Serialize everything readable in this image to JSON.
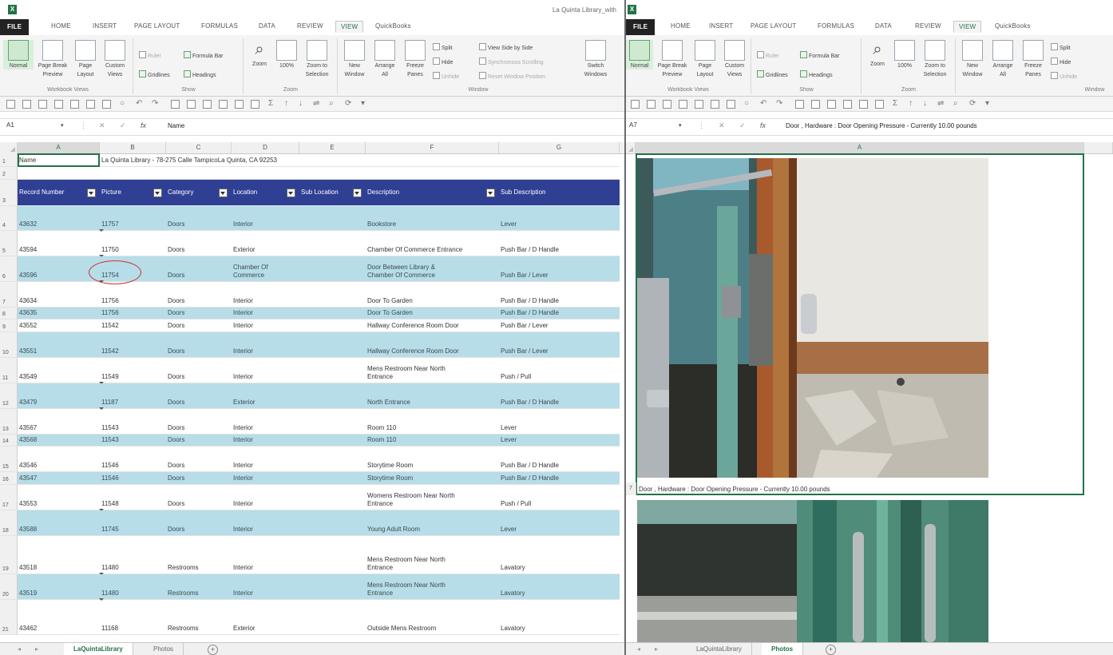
{
  "app": {
    "left_logo": "X",
    "right_logo": "X",
    "window_title": "La Quinta Library_with"
  },
  "ribbon": {
    "tabs": [
      "FILE",
      "HOME",
      "INSERT",
      "PAGE LAYOUT",
      "FORMULAS",
      "DATA",
      "REVIEW",
      "VIEW",
      "QuickBooks"
    ],
    "active_tab": "VIEW",
    "workbook_views": {
      "label": "Workbook Views",
      "normal": "Normal",
      "page_break_1": "Page Break",
      "page_break_2": "Preview",
      "page_layout_1": "Page",
      "page_layout_2": "Layout",
      "custom_1": "Custom",
      "custom_2": "Views"
    },
    "show": {
      "label": "Show",
      "ruler": "Ruler",
      "formula_bar": "Formula Bar",
      "gridlines": "Gridlines",
      "headings": "Headings"
    },
    "zoom": {
      "label": "Zoom",
      "zoom": "Zoom",
      "z100": "100%",
      "zts_1": "Zoom to",
      "zts_2": "Selection"
    },
    "window": {
      "label": "Window",
      "new_1": "New",
      "new_2": "Window",
      "arrange_1": "Arrange",
      "arrange_2": "All",
      "freeze_1": "Freeze",
      "freeze_2": "Panes",
      "split": "Split",
      "hide": "Hide",
      "unhide": "Unhide",
      "side_by_side": "View Side by Side",
      "sync_scroll": "Synchronous Scrolling",
      "reset_pos": "Reset Window Position",
      "switch_1": "Switch",
      "switch_2": "Windows"
    }
  },
  "left": {
    "namebox": "A1",
    "formula": "Name",
    "fx": "fx",
    "columns": [
      "A",
      "B",
      "C",
      "D",
      "E",
      "F",
      "G"
    ],
    "row1": {
      "num": "1",
      "a": "Name",
      "b": "La Quinta Library - 78-275 Calle TampicoLa Quinta, CA 92253"
    },
    "row2": {
      "num": "2"
    },
    "header": {
      "num": "3",
      "cells": [
        "Record Number",
        "Picture",
        "Category",
        "Location",
        "Sub Location",
        "Description",
        "Sub Description"
      ]
    },
    "rows": [
      {
        "num": "4",
        "rec": "43632",
        "pic": "11757",
        "cat": "Doors",
        "loc": "Interior",
        "desc": "Bookstore",
        "sub": "Lever"
      },
      {
        "num": "5",
        "rec": "43594",
        "pic": "11750",
        "cat": "Doors",
        "loc": "Exterior",
        "desc": "Chamber Of Commerce Entrance",
        "sub": "Push Bar / D Handle"
      },
      {
        "num": "6",
        "rec": "43596",
        "pic": "11754",
        "cat": "Doors",
        "loc_1": "Chamber Of",
        "loc_2": "Commerce",
        "desc_1": "Door Between Library &",
        "desc_2": "Chamber Of Commerce",
        "sub": "Push Bar / Lever"
      },
      {
        "num": "7",
        "rec": "43634",
        "pic": "11756",
        "cat": "Doors",
        "loc": "Interior",
        "desc": "Door To Garden",
        "sub": "Push Bar / D Handle"
      },
      {
        "num": "8",
        "rec": "43635",
        "pic": "11756",
        "cat": "Doors",
        "loc": "Interior",
        "desc": "Door To Garden",
        "sub": "Push Bar / D Handle"
      },
      {
        "num": "9",
        "rec": "43552",
        "pic": "11542",
        "cat": "Doors",
        "loc": "Interior",
        "desc": "Hallway Conference Room Door",
        "sub": "Push Bar / Lever"
      },
      {
        "num": "10",
        "rec": "43551",
        "pic": "11542",
        "cat": "Doors",
        "loc": "Interior",
        "desc": "Hallway Conference Room Door",
        "sub": "Push Bar / Lever"
      },
      {
        "num": "11",
        "rec": "43549",
        "pic": "11549",
        "cat": "Doors",
        "loc": "Interior",
        "desc_1": "Mens Restroom Near North",
        "desc_2": "Entrance",
        "sub": "Push / Pull"
      },
      {
        "num": "12",
        "rec": "43479",
        "pic": "11187",
        "cat": "Doors",
        "loc": "Exterior",
        "desc": "North Entrance",
        "sub": "Push Bar / D Handle"
      },
      {
        "num": "13",
        "rec": "43567",
        "pic": "11543",
        "cat": "Doors",
        "loc": "Interior",
        "desc": "Room 110",
        "sub": "Lever"
      },
      {
        "num": "14",
        "rec": "43568",
        "pic": "11543",
        "cat": "Doors",
        "loc": "Interior",
        "desc": "Room 110",
        "sub": "Lever"
      },
      {
        "num": "15",
        "rec": "43546",
        "pic": "11546",
        "cat": "Doors",
        "loc": "Interior",
        "desc": "Storytime Room",
        "sub": "Push Bar / D Handle"
      },
      {
        "num": "16",
        "rec": "43547",
        "pic": "11546",
        "cat": "Doors",
        "loc": "Interior",
        "desc": "Storytime Room",
        "sub": "Push Bar / D Handle"
      },
      {
        "num": "17",
        "rec": "43553",
        "pic": "11548",
        "cat": "Doors",
        "loc": "Interior",
        "desc_1": "Womens Restroom Near North",
        "desc_2": "Entrance",
        "sub": "Push / Pull"
      },
      {
        "num": "18",
        "rec": "43588",
        "pic": "11745",
        "cat": "Doors",
        "loc": "Interior",
        "desc": "Young Adult Room",
        "sub": "Lever"
      },
      {
        "num": "19",
        "rec": "43518",
        "pic": "11480",
        "cat": "Restrooms",
        "loc": "Interior",
        "desc_1": "Mens Restroom Near North",
        "desc_2": "Entrance",
        "sub": "Lavatory"
      },
      {
        "num": "20",
        "rec": "43519",
        "pic": "11480",
        "cat": "Restrooms",
        "loc": "Interior",
        "desc_1": "Mens Restroom Near North",
        "desc_2": "Entrance",
        "sub": "Lavatory"
      },
      {
        "num": "21",
        "rec": "43462",
        "pic": "11168",
        "cat": "Restrooms",
        "loc": "Exterior",
        "desc": "Outside Mens Restroom",
        "sub": "Lavatory"
      }
    ],
    "sheet_tabs": [
      "LaQuintaLibrary",
      "Photos"
    ],
    "active_sheet": "LaQuintaLibrary"
  },
  "right": {
    "namebox": "A7",
    "formula": "Door , Hardware  :  Door Opening Pressure - Currently 10.00 pounds",
    "fx": "fx",
    "column": "A",
    "row7_num": "7",
    "row7_text": "Door , Hardware  :  Door Opening Pressure - Currently 10.00 pounds",
    "sheet_tabs": [
      "LaQuintaLibrary",
      "Photos"
    ],
    "active_sheet": "Photos"
  },
  "colors": {
    "excel_green": "#217346",
    "table_header": "#2f3f93",
    "band_row": "#b7dde8",
    "annotation_circle": "#cc3333"
  }
}
